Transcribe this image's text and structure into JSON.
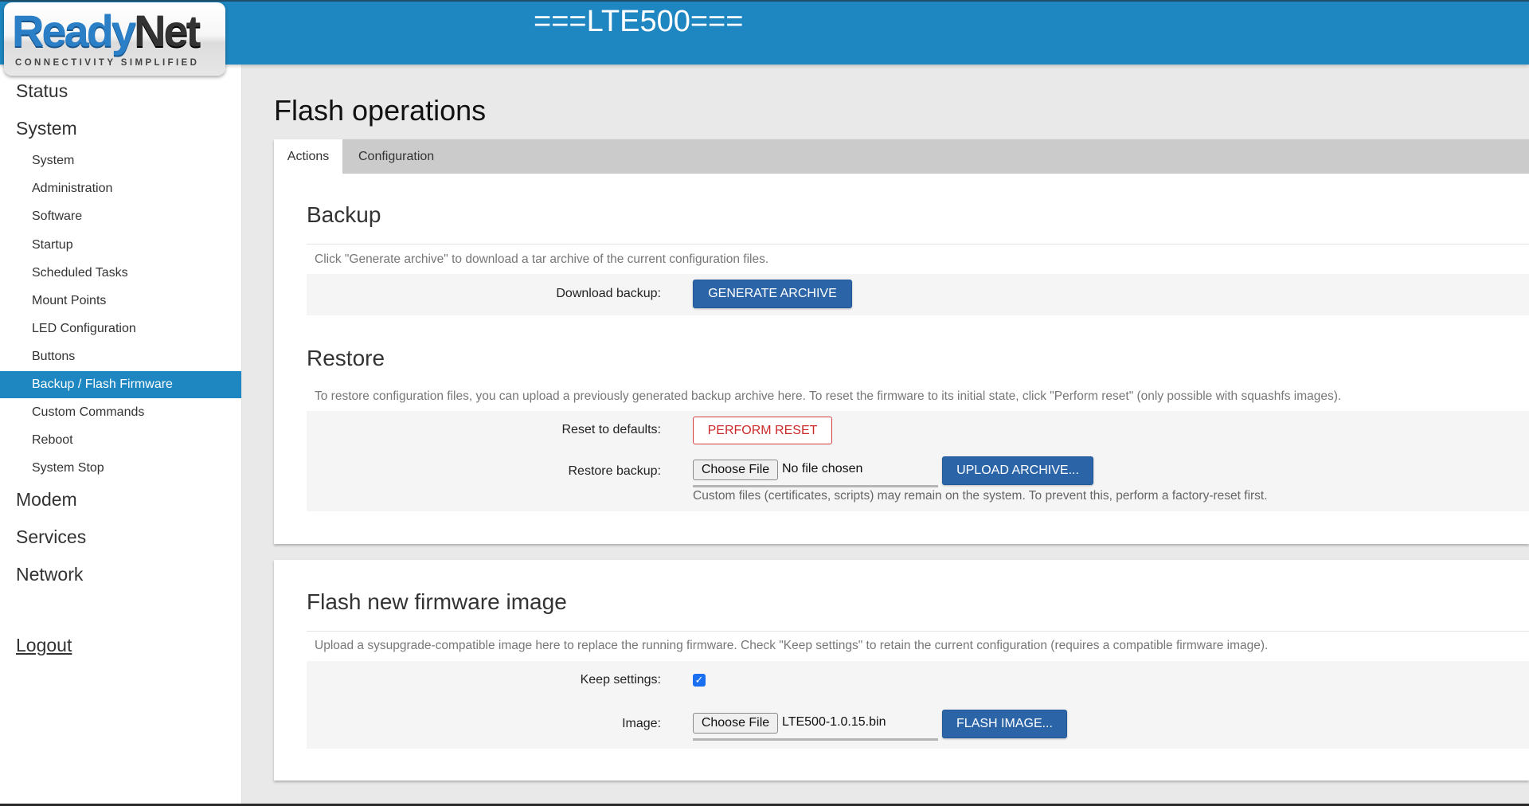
{
  "header": {
    "title": "===LTE500===",
    "logo_brand_part1": "Ready",
    "logo_brand_part2": "Net",
    "logo_tagline": "CONNECTIVITY SIMPLIFIED"
  },
  "sidebar": {
    "top_items": [
      {
        "label": "Status"
      },
      {
        "label": "System"
      },
      {
        "label": "Modem"
      },
      {
        "label": "Services"
      },
      {
        "label": "Network"
      }
    ],
    "system_items": [
      {
        "label": "System"
      },
      {
        "label": "Administration"
      },
      {
        "label": "Software"
      },
      {
        "label": "Startup"
      },
      {
        "label": "Scheduled Tasks"
      },
      {
        "label": "Mount Points"
      },
      {
        "label": "LED Configuration"
      },
      {
        "label": "Buttons"
      },
      {
        "label": "Backup / Flash Firmware",
        "active": true
      },
      {
        "label": "Custom Commands"
      },
      {
        "label": "Reboot"
      },
      {
        "label": "System Stop"
      }
    ],
    "logout": "Logout"
  },
  "main": {
    "page_title": "Flash operations",
    "tabs": [
      {
        "label": "Actions",
        "active": true
      },
      {
        "label": "Configuration",
        "active": false
      }
    ],
    "backup": {
      "title": "Backup",
      "description": "Click \"Generate archive\" to download a tar archive of the current configuration files.",
      "download_label": "Download backup:",
      "generate_button": "GENERATE ARCHIVE"
    },
    "restore": {
      "title": "Restore",
      "description": "To restore configuration files, you can upload a previously generated backup archive here. To reset the firmware to its initial state, click \"Perform reset\" (only possible with squashfs images).",
      "reset_label": "Reset to defaults:",
      "reset_button": "PERFORM RESET",
      "restore_label": "Restore backup:",
      "choose_file_button": "Choose File",
      "file_value": "No file chosen",
      "upload_button": "UPLOAD ARCHIVE...",
      "helper": "Custom files (certificates, scripts) may remain on the system. To prevent this, perform a factory-reset first."
    },
    "flash": {
      "title": "Flash new firmware image",
      "description": "Upload a sysupgrade-compatible image here to replace the running firmware. Check \"Keep settings\" to retain the current configuration (requires a compatible firmware image).",
      "keep_label": "Keep settings:",
      "keep_checked": true,
      "checkmark": "✓",
      "image_label": "Image:",
      "choose_file_button": "Choose File",
      "file_value": "LTE500-1.0.15.bin",
      "flash_button": "FLASH IMAGE..."
    }
  },
  "colors": {
    "header_blue": "#1e86c1",
    "primary_button": "#2b65a8",
    "danger": "#cc2a2a",
    "checkbox": "#1a6ff0"
  }
}
